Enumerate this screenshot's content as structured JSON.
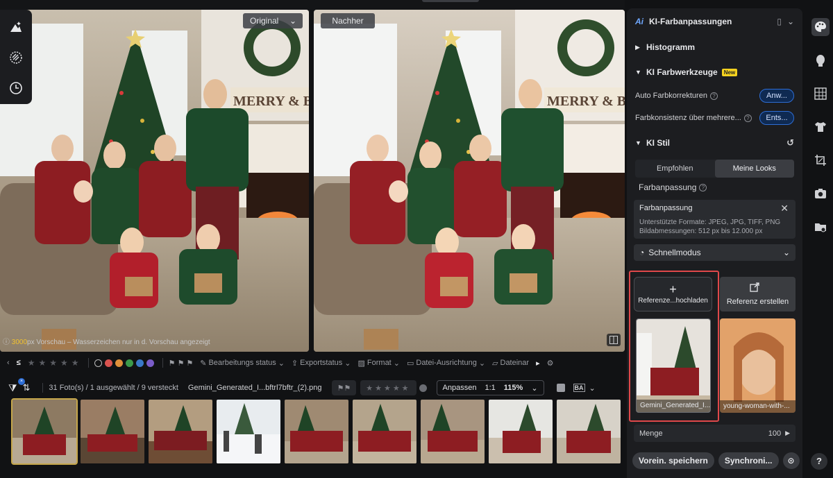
{
  "preview": {
    "original_label": "Original",
    "after_label": "Nachher",
    "note_size": "3000",
    "note_text": "px Vorschau – Wasserzeichen nur in d. Vorschau angezeigt",
    "sign_text": "MERRY & BRI"
  },
  "toolbar": {
    "stars": [
      "★",
      "★",
      "★",
      "★",
      "★"
    ],
    "items": [
      "Bearbeitungs status",
      "Exportstatus",
      "Format",
      "Datei-Ausrichtung",
      "Dateinar"
    ],
    "colors": [
      "#d9534f",
      "#e0903a",
      "#3c9a4a",
      "#3a78c8",
      "#7a5cc8"
    ]
  },
  "status": {
    "counts": "31 Foto(s) / 1 ausgewählt / 9 versteckt",
    "filename": "Gemini_Generated_I...bftrl7bftr_(2).png",
    "fit_label": "Anpassen",
    "ratio": "1:1",
    "zoom": "115%"
  },
  "panel": {
    "title": "KI-Farbanpassungen",
    "histogram": "Histogramm",
    "tools_title": "KI Farbwerkzeuge",
    "new_badge": "New",
    "auto_label": "Auto Farbkorrekturen",
    "auto_btn": "Anw...",
    "consistency_label": "Farbkonsistenz über mehrere...",
    "consistency_btn": "Ents...",
    "style_title": "KI Stil",
    "tab_recommended": "Empfohlen",
    "tab_mylooks": "Meine Looks",
    "subhead": "Farbanpassung",
    "card_title": "Farbanpassung",
    "card_desc1": "Unterstützte Formate: JPEG, JPG, TIFF, PNG",
    "card_desc2": "Bildabmessungen: 512 px bis 12.000 px",
    "mode": "Schnellmodus",
    "upload_label": "Referenze...hochladen",
    "create_label": "Referenz erstellen",
    "look1": "Gemini_Generated_I...",
    "look2": "young-woman-with-...",
    "amount_label": "Menge",
    "amount_value": "100",
    "save_btn": "Vorein. speichern",
    "sync_btn": "Synchroni..."
  },
  "help": "?"
}
